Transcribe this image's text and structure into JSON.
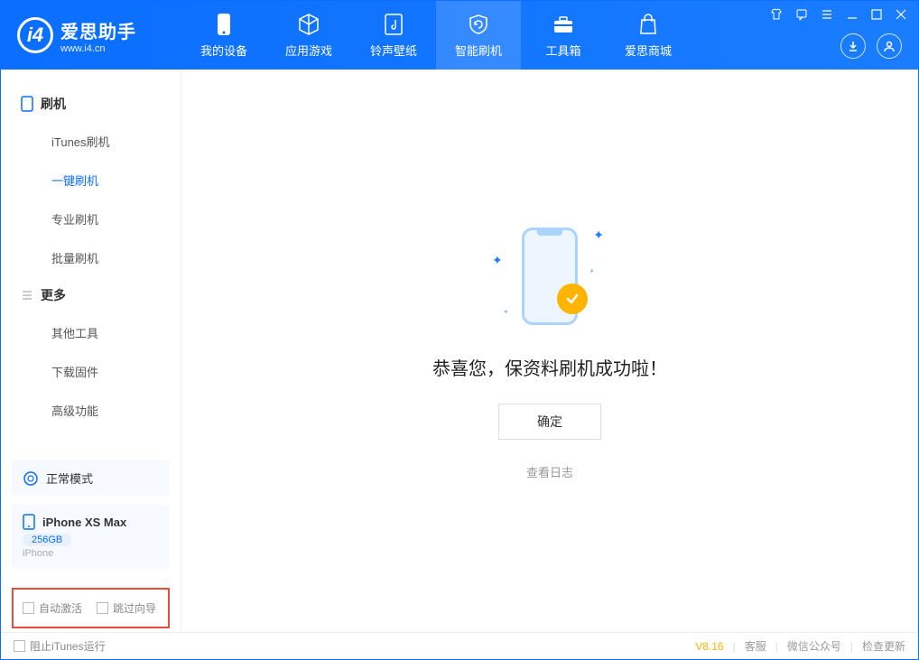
{
  "app": {
    "title": "爱思助手",
    "subtitle": "www.i4.cn"
  },
  "nav": [
    {
      "label": "我的设备"
    },
    {
      "label": "应用游戏"
    },
    {
      "label": "铃声壁纸"
    },
    {
      "label": "智能刷机"
    },
    {
      "label": "工具箱"
    },
    {
      "label": "爱思商城"
    }
  ],
  "sidebar": {
    "section1": {
      "title": "刷机",
      "items": [
        "iTunes刷机",
        "一键刷机",
        "专业刷机",
        "批量刷机"
      ]
    },
    "section2": {
      "title": "更多",
      "items": [
        "其他工具",
        "下载固件",
        "高级功能"
      ]
    }
  },
  "mode_card": {
    "label": "正常模式"
  },
  "device_card": {
    "name": "iPhone XS Max",
    "storage": "256GB",
    "type": "iPhone"
  },
  "redbox": {
    "chk1": "自动激活",
    "chk2": "跳过向导"
  },
  "main": {
    "success_msg": "恭喜您，保资料刷机成功啦！",
    "ok": "确定",
    "view_log": "查看日志"
  },
  "footer": {
    "block_itunes": "阻止iTunes运行",
    "version": "V8.16",
    "links": [
      "客服",
      "微信公众号",
      "检查更新"
    ]
  }
}
